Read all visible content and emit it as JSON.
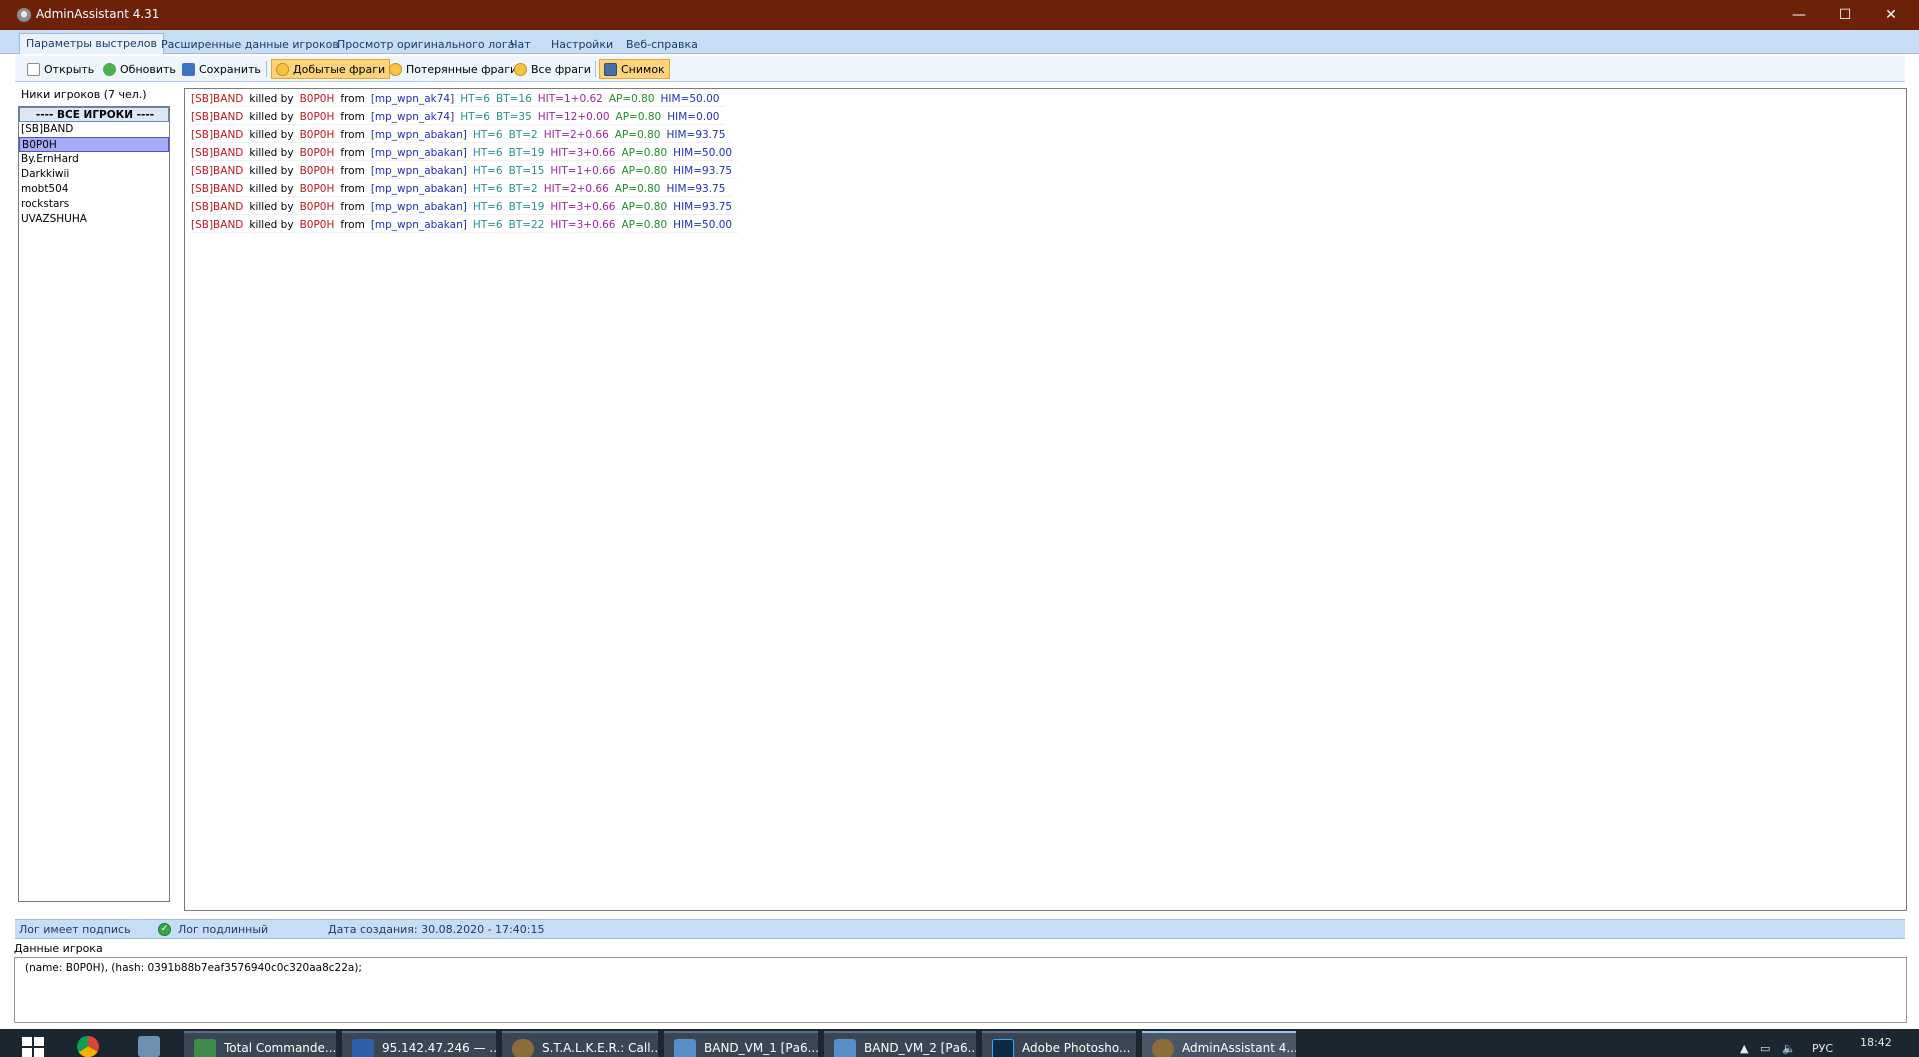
{
  "window": {
    "title": "AdminAssistant 4.31",
    "controls": {
      "minimize": "—",
      "maximize": "☐",
      "close": "✕"
    }
  },
  "tabs": [
    {
      "label": "Параметры выстрелов",
      "active": true
    },
    {
      "label": "Расширенные данные игроков"
    },
    {
      "label": "Просмотр оригинального лога"
    },
    {
      "label": "Чат"
    },
    {
      "label": "Настройки"
    },
    {
      "label": "Веб-справка"
    }
  ],
  "toolbar": {
    "open": "Открыть",
    "refresh": "Обновить",
    "save": "Сохранить",
    "gained_frags": "Добытые фраги",
    "lost_frags": "Потерянные фраги",
    "all_frags": "Все фраги",
    "snapshot": "Снимок"
  },
  "players": {
    "caption": "Ники игроков (7 чел.)",
    "all_label": "---- ВСЕ ИГРОКИ ----",
    "items": [
      "[SB]BAND",
      "B0P0H",
      "By.ErnHard",
      "Darkkiwii",
      "mobt504",
      "rockstars",
      "UVAZSHUHA"
    ],
    "selected": "B0P0H"
  },
  "log": {
    "rows": [
      {
        "victim": "[SB]BAND",
        "killed": "killed by",
        "killer": "B0P0H",
        "from": "from",
        "weapon": "[mp_wpn_ak74]",
        "ht": "HT=6",
        "bt": "BT=16",
        "hit": "HIT=1+0.62",
        "ap": "AP=0.80",
        "him": "HIM=50.00"
      },
      {
        "victim": "[SB]BAND",
        "killed": "killed by",
        "killer": "B0P0H",
        "from": "from",
        "weapon": "[mp_wpn_ak74]",
        "ht": "HT=6",
        "bt": "BT=35",
        "hit": "HIT=12+0.00",
        "ap": "AP=0.80",
        "him": "HIM=0.00"
      },
      {
        "victim": "[SB]BAND",
        "killed": "killed by",
        "killer": "B0P0H",
        "from": "from",
        "weapon": "[mp_wpn_abakan]",
        "ht": "HT=6",
        "bt": "BT=2",
        "hit": "HIT=2+0.66",
        "ap": "AP=0.80",
        "him": "HIM=93.75"
      },
      {
        "victim": "[SB]BAND",
        "killed": "killed by",
        "killer": "B0P0H",
        "from": "from",
        "weapon": "[mp_wpn_abakan]",
        "ht": "HT=6",
        "bt": "BT=19",
        "hit": "HIT=3+0.66",
        "ap": "AP=0.80",
        "him": "HIM=50.00"
      },
      {
        "victim": "[SB]BAND",
        "killed": "killed by",
        "killer": "B0P0H",
        "from": "from",
        "weapon": "[mp_wpn_abakan]",
        "ht": "HT=6",
        "bt": "BT=15",
        "hit": "HIT=1+0.66",
        "ap": "AP=0.80",
        "him": "HIM=93.75"
      },
      {
        "victim": "[SB]BAND",
        "killed": "killed by",
        "killer": "B0P0H",
        "from": "from",
        "weapon": "[mp_wpn_abakan]",
        "ht": "HT=6",
        "bt": "BT=2",
        "hit": "HIT=2+0.66",
        "ap": "AP=0.80",
        "him": "HIM=93.75"
      },
      {
        "victim": "[SB]BAND",
        "killed": "killed by",
        "killer": "B0P0H",
        "from": "from",
        "weapon": "[mp_wpn_abakan]",
        "ht": "HT=6",
        "bt": "BT=19",
        "hit": "HIT=3+0.66",
        "ap": "AP=0.80",
        "him": "HIM=93.75"
      },
      {
        "victim": "[SB]BAND",
        "killed": "killed by",
        "killer": "B0P0H",
        "from": "from",
        "weapon": "[mp_wpn_abakan]",
        "ht": "HT=6",
        "bt": "BT=22",
        "hit": "HIT=3+0.66",
        "ap": "AP=0.80",
        "him": "HIM=50.00"
      }
    ]
  },
  "status": {
    "signed": "Лог имеет подпись",
    "authentic": "Лог подлинный",
    "created": "Дата создания: 30.08.2020 - 17:40:15"
  },
  "player_data": {
    "label": "Данные игрока",
    "text": "(name: B0P0H), (hash: 0391b88b7eaf3576940c0c320aa8c22a);"
  },
  "taskbar": {
    "items": [
      {
        "label": "Total Commande..."
      },
      {
        "label": "95.142.47.246 — ..."
      },
      {
        "label": "S.T.A.L.K.E.R.: Call..."
      },
      {
        "label": "BAND_VM_1 [Ра6..."
      },
      {
        "label": "BAND_VM_2 [Ра6..."
      },
      {
        "label": "Adobe Photosho..."
      },
      {
        "label": "AdminAssistant 4...."
      }
    ],
    "lang": "РУС",
    "clock": "18:42"
  }
}
